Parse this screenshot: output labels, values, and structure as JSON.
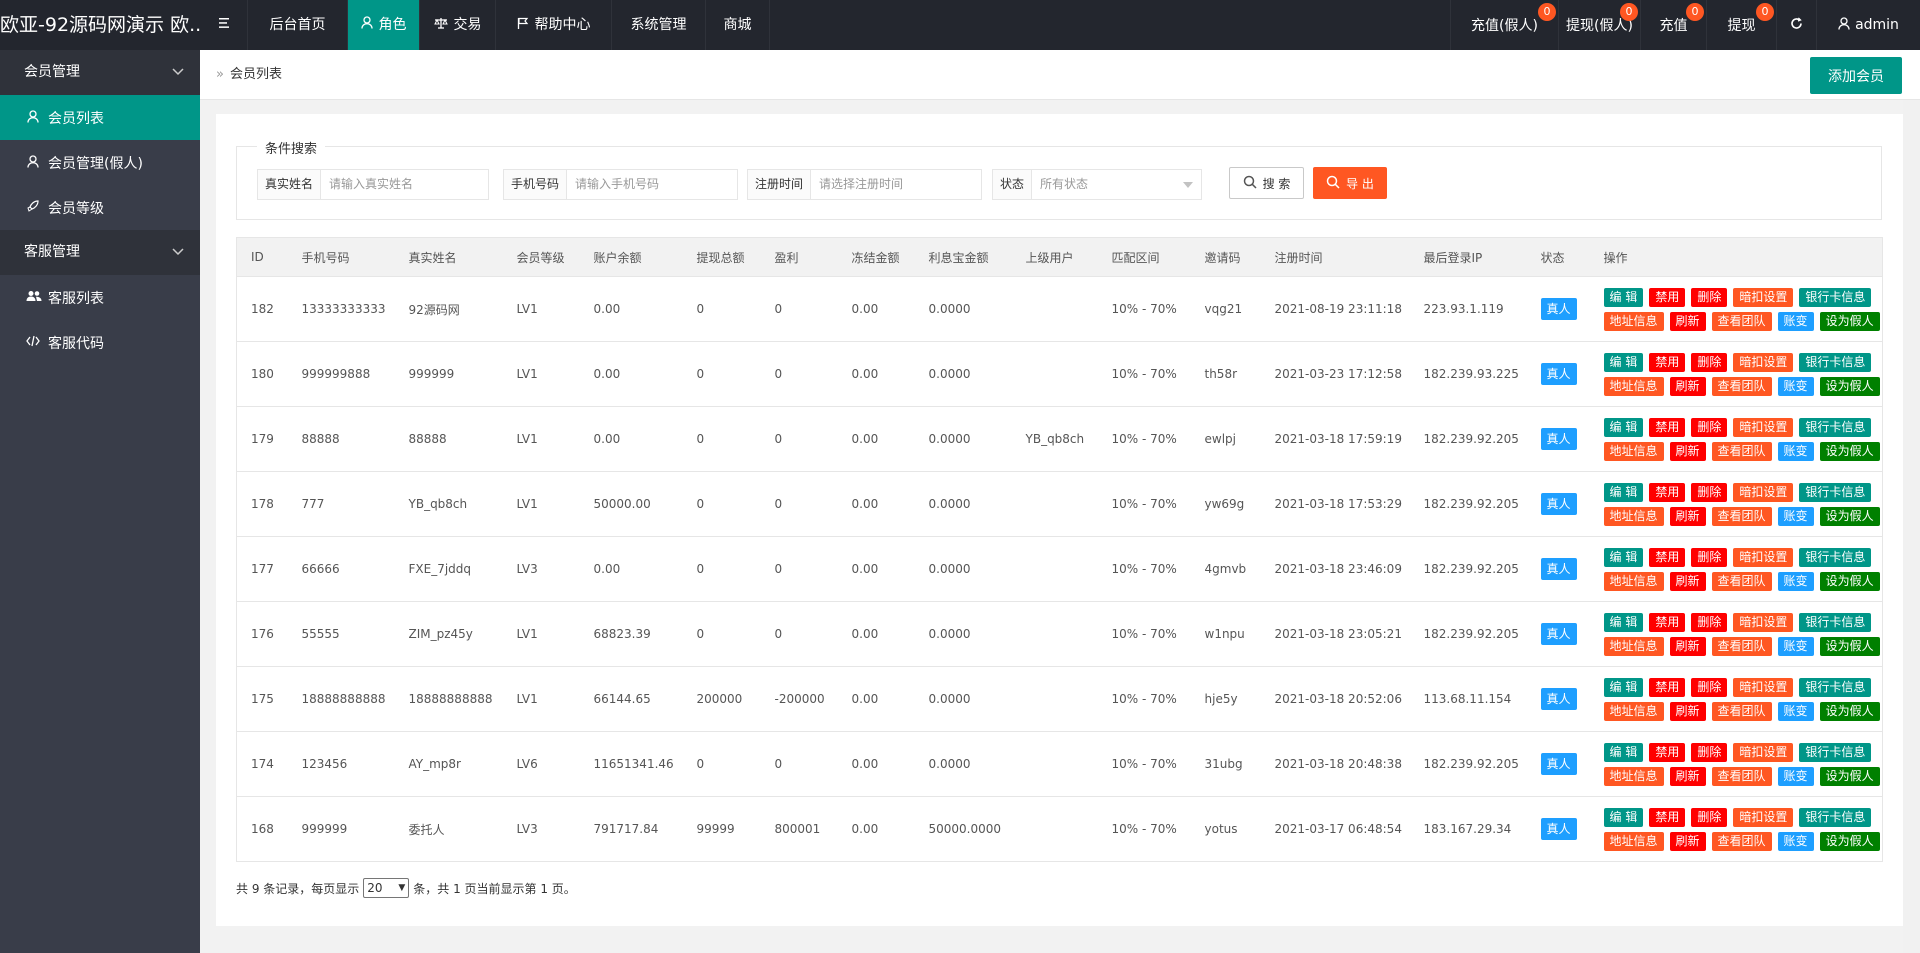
{
  "app": {
    "title": "欧亚-92源码网演示 欧..."
  },
  "topnav": [
    {
      "label": "",
      "icon": "menu-icon"
    },
    {
      "label": "后台首页",
      "icon": ""
    },
    {
      "label": "角色",
      "icon": "user-icon",
      "active": true
    },
    {
      "label": "交易",
      "icon": "scale-icon"
    },
    {
      "label": "帮助中心",
      "icon": "flag-icon"
    },
    {
      "label": "系统管理",
      "icon": ""
    },
    {
      "label": "商城",
      "icon": ""
    }
  ],
  "topright": [
    {
      "label": "充值(假人)",
      "badge": "0"
    },
    {
      "label": "提现(假人)",
      "badge": "0"
    },
    {
      "label": "充值",
      "badge": "0"
    },
    {
      "label": "提现",
      "badge": "0"
    },
    {
      "label": "",
      "icon": "refresh-icon"
    },
    {
      "label": "admin",
      "icon": "user-icon"
    }
  ],
  "sidebar": {
    "groups": [
      {
        "label": "会员管理",
        "items": [
          {
            "label": "会员列表",
            "icon": "user-icon",
            "active": true
          },
          {
            "label": "会员管理(假人)",
            "icon": "user-icon"
          },
          {
            "label": "会员等级",
            "icon": "rocket-icon"
          }
        ]
      },
      {
        "label": "客服管理",
        "items": [
          {
            "label": "客服列表",
            "icon": "users-icon"
          },
          {
            "label": "客服代码",
            "icon": "code-icon"
          }
        ]
      }
    ]
  },
  "breadcrumb": {
    "current": "会员列表"
  },
  "add_button": "添加会员",
  "search": {
    "legend": "条件搜索",
    "fields": [
      {
        "label": "真实姓名",
        "placeholder": "请输入真实姓名"
      },
      {
        "label": "手机号码",
        "placeholder": "请输入手机号码"
      },
      {
        "label": "注册时间",
        "placeholder": "请选择注册时间"
      },
      {
        "label": "状态",
        "placeholder": "所有状态"
      }
    ],
    "search_btn": "搜 索",
    "export_btn": "导 出"
  },
  "table": {
    "columns": [
      "ID",
      "手机号码",
      "真实姓名",
      "会员等级",
      "账户余额",
      "提现总额",
      "盈利",
      "冻结金额",
      "利息宝金额",
      "上级用户",
      "匹配区间",
      "邀请码",
      "注册时间",
      "最后登录IP",
      "状态",
      "操作"
    ],
    "rows": [
      [
        "182",
        "13333333333",
        "92源码网",
        "LV1",
        "0.00",
        "0",
        "0",
        "0.00",
        "0.0000",
        "",
        "10% - 70%",
        "vqg21",
        "2021-08-19 23:11:18",
        "223.93.1.119",
        "真人"
      ],
      [
        "180",
        "999999888",
        "999999",
        "LV1",
        "0.00",
        "0",
        "0",
        "0.00",
        "0.0000",
        "",
        "10% - 70%",
        "th58r",
        "2021-03-23 17:12:58",
        "182.239.93.225",
        "真人"
      ],
      [
        "179",
        "88888",
        "88888",
        "LV1",
        "0.00",
        "0",
        "0",
        "0.00",
        "0.0000",
        "YB_qb8ch",
        "10% - 70%",
        "ewlpj",
        "2021-03-18 17:59:19",
        "182.239.92.205",
        "真人"
      ],
      [
        "178",
        "777",
        "YB_qb8ch",
        "LV1",
        "50000.00",
        "0",
        "0",
        "0.00",
        "0.0000",
        "",
        "10% - 70%",
        "yw69g",
        "2021-03-18 17:53:29",
        "182.239.92.205",
        "真人"
      ],
      [
        "177",
        "66666",
        "FXE_7jddq",
        "LV3",
        "0.00",
        "0",
        "0",
        "0.00",
        "0.0000",
        "",
        "10% - 70%",
        "4gmvb",
        "2021-03-18 23:46:09",
        "182.239.92.205",
        "真人"
      ],
      [
        "176",
        "55555",
        "ZIM_pz45y",
        "LV1",
        "68823.39",
        "0",
        "0",
        "0.00",
        "0.0000",
        "",
        "10% - 70%",
        "w1npu",
        "2021-03-18 23:05:21",
        "182.239.92.205",
        "真人"
      ],
      [
        "175",
        "18888888888",
        "18888888888",
        "LV1",
        "66144.65",
        "200000",
        "-200000",
        "0.00",
        "0.0000",
        "",
        "10% - 70%",
        "hje5y",
        "2021-03-18 20:52:06",
        "113.68.11.154",
        "真人"
      ],
      [
        "174",
        "123456",
        "AY_mp8r",
        "LV6",
        "11651341.46",
        "0",
        "0",
        "0.00",
        "0.0000",
        "",
        "10% - 70%",
        "31ubg",
        "2021-03-18 20:48:38",
        "182.239.92.205",
        "真人"
      ],
      [
        "168",
        "999999",
        "委托人",
        "LV3",
        "791717.84",
        "99999",
        "800001",
        "0.00",
        "50000.0000",
        "",
        "10% - 70%",
        "yotus",
        "2021-03-17 06:48:54",
        "183.167.29.34",
        "真人"
      ]
    ],
    "ops": [
      {
        "label": "编 辑",
        "cls": "op-edit",
        "name": "edit-button"
      },
      {
        "label": "禁用",
        "cls": "op-ban",
        "name": "disable-button"
      },
      {
        "label": "删除",
        "cls": "op-del",
        "name": "delete-button"
      },
      {
        "label": "暗扣设置",
        "cls": "op-deduct",
        "name": "deduct-settings-button"
      },
      {
        "label": "银行卡信息",
        "cls": "op-bank",
        "name": "bank-card-button"
      },
      {
        "label": "地址信息",
        "cls": "op-addr",
        "name": "address-button"
      },
      {
        "label": "刷新",
        "cls": "op-refresh",
        "name": "refresh-button"
      },
      {
        "label": "查看团队",
        "cls": "op-team",
        "name": "view-team-button"
      },
      {
        "label": "账变",
        "cls": "op-change",
        "name": "account-change-button"
      },
      {
        "label": "设为假人",
        "cls": "op-fake",
        "name": "set-fake-button"
      }
    ]
  },
  "pagination": {
    "prefix": "共 9 条记录，每页显示",
    "page_size": "20",
    "suffix": "条，共 1 页当前显示第 1 页。"
  }
}
